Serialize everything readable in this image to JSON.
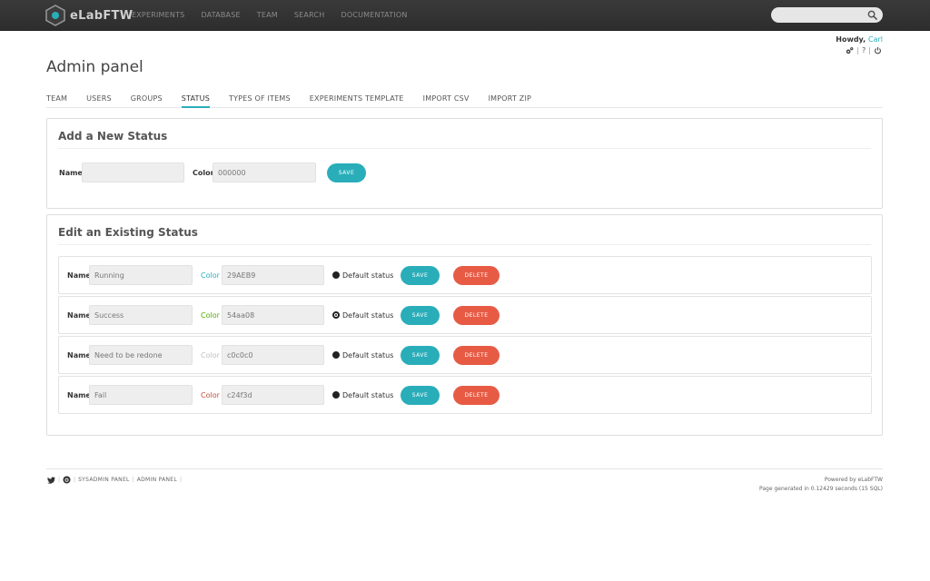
{
  "app": {
    "name": "eLabFTW",
    "nav": [
      "EXPERIMENTS",
      "DATABASE",
      "TEAM",
      "SEARCH",
      "DOCUMENTATION"
    ],
    "search_placeholder": ""
  },
  "user": {
    "greeting": "Howdy,",
    "name": "Carl",
    "tools_sep": "|",
    "help": "?"
  },
  "page": {
    "title": "Admin panel"
  },
  "tabs": [
    {
      "label": "TEAM",
      "active": false
    },
    {
      "label": "USERS",
      "active": false
    },
    {
      "label": "GROUPS",
      "active": false
    },
    {
      "label": "STATUS",
      "active": true
    },
    {
      "label": "TYPES OF ITEMS",
      "active": false
    },
    {
      "label": "EXPERIMENTS TEMPLATE",
      "active": false
    },
    {
      "label": "IMPORT CSV",
      "active": false
    },
    {
      "label": "IMPORT ZIP",
      "active": false
    }
  ],
  "add_status": {
    "title": "Add a New Status",
    "name_label": "Name",
    "name_value": "",
    "color_label": "Color",
    "color_value": "000000",
    "save_label": "SAVE"
  },
  "edit_status": {
    "title": "Edit an Existing Status",
    "name_label": "Name",
    "color_label": "Color",
    "default_label": "Default status",
    "save_label": "SAVE",
    "delete_label": "DELETE",
    "rows": [
      {
        "name": "Running",
        "color": "29AEB9",
        "color_hex": "#29aeb9",
        "default": false
      },
      {
        "name": "Success",
        "color": "54aa08",
        "color_hex": "#54aa08",
        "default": true
      },
      {
        "name": "Need to be redone",
        "color": "c0c0c0",
        "color_hex": "#c0c0c0",
        "default": false
      },
      {
        "name": "Fail",
        "color": "c24f3d",
        "color_hex": "#c24f3d",
        "default": false
      }
    ]
  },
  "footer": {
    "links": [
      "SYSADMIN PANEL",
      "ADMIN PANEL"
    ],
    "powered": "Powered by eLabFTW",
    "generated": "Page generated in 0.12429 seconds (15 SQL)"
  },
  "colors": {
    "accent": "#29aeb9",
    "danger": "#e75b45",
    "topbar": "#333333"
  }
}
